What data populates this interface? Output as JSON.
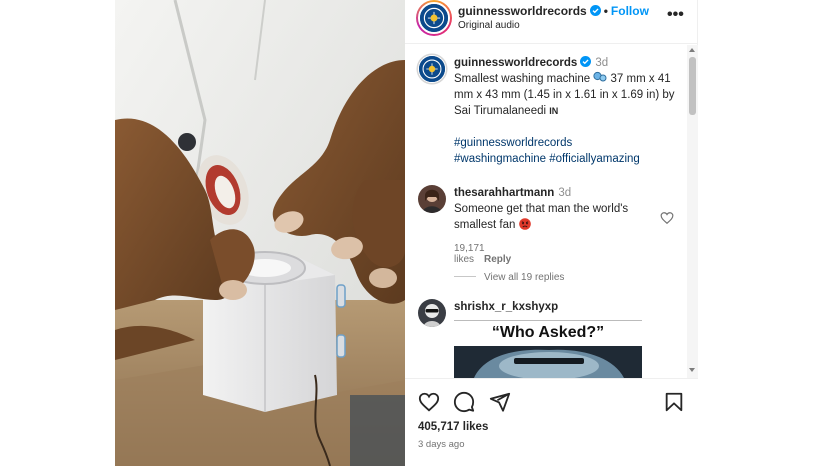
{
  "post": {
    "username": "guinnessworldrecords",
    "follow_label": "Follow",
    "dot": "•",
    "audio": "Original audio",
    "more": "•••"
  },
  "caption": {
    "username": "guinnessworldrecords",
    "time": "3d",
    "text_before_emoji": "Smallest washing machine ",
    "text_after_emoji": " 37 mm x 41 mm x 43 mm (1.45 in x 1.61 in x 1.69 in) by Sai Tirumalaneedi ",
    "flag": "IN",
    "hashtags_line1": "#guinnessworldrecords",
    "hashtags_line2": "#washingmachine #officiallyamazing"
  },
  "comments": [
    {
      "username": "thesarahhartmann",
      "time": "3d",
      "text": "Someone get that man the world's smallest fan ",
      "likes": "19,171 likes",
      "reply": "Reply",
      "view_replies": "View all 19 replies"
    },
    {
      "username": "shrishx_r_kxshyxp",
      "meme_text": "“Who Asked?”"
    }
  ],
  "footer": {
    "likes": "405,717 likes",
    "ago": "3 days ago"
  },
  "colors": {
    "link": "#0095f6",
    "hashtag": "#00376b",
    "verified": "#0095f6",
    "meta": "#737373"
  }
}
